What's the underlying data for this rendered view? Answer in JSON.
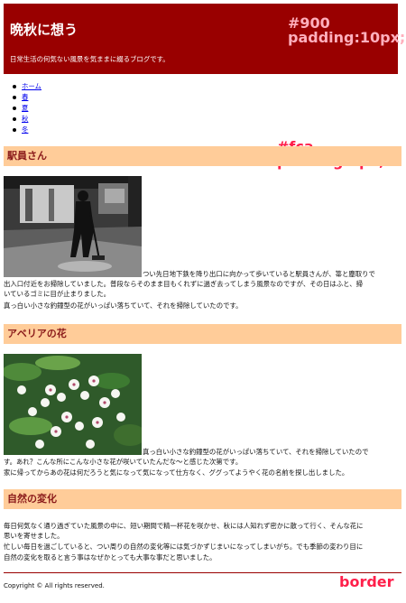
{
  "header": {
    "title": "晩秋に想う",
    "description": "日常生活の何気ない風景を気ままに綴るブログです。"
  },
  "annotations": {
    "header_bg_line1": "#900",
    "header_bg_line2": "padding:10px;",
    "section_bg_line1": "#fca",
    "section_bg_line2": "padding:5px;",
    "footer_border": "border"
  },
  "nav": {
    "items": [
      "ホーム",
      "春",
      "夏",
      "秋",
      "冬"
    ]
  },
  "sections": [
    {
      "heading": "駅員さん",
      "text_line1_inline": "つい先日地下鉄を降り出口に向かって歩いていると駅員さんが、箒と塵取りで",
      "text_line2": "出入口付近をお掃除していました。普段ならそのまま目もくれずに過ぎ去ってしまう風景なのですが、その日はふと、掃",
      "text_line3": "いているゴミに目が止まりました。",
      "text_line4": "真っ白い小さな釣鐘型の花がいっぱい落ちていて、それを掃除していたのです。"
    },
    {
      "heading": "アベリアの花",
      "text_line1_inline": "真っ白い小さな釣鐘型の花がいっぱい落ちていて、それを掃除していたので",
      "text_line2": "す。あれ？こんな所にこんな小さな花が咲いていたんだな〜と感じた次第です。",
      "text_line3": "家に帰ってからあの花は何だろうと気になって気になって仕方なく、ググってようやく花の名前を探し出しました。"
    },
    {
      "heading": "自然の変化",
      "text_line1": "毎日何気なく通り過ぎていた風景の中に、短い期間で精一杯花を咲かせ、秋には人知れず密かに散って行く、そんな花に",
      "text_line2": "思いを寄せました。",
      "text_line3": "忙しい毎日を過ごしていると、つい周りの自然の変化等には気づかずじまいになってしまいがち。でも季節の変わり目に",
      "text_line4": "自然の変化を取ると言う事はなぜかとっても大事な事だと思いました。"
    }
  ],
  "footer": {
    "copyright": "Copyright © All rights reserved."
  },
  "colors": {
    "header_bg": "#990000",
    "section_bg": "#ffcc99",
    "heading_text": "#8a1a1a",
    "annotation": "#ff1f4a"
  }
}
